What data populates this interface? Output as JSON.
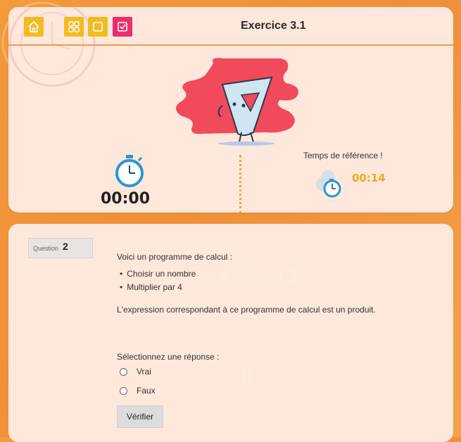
{
  "header": {
    "title": "Exercice 3.1",
    "buttons": [
      {
        "name": "home-button",
        "icon": "home-icon",
        "color": "#f2bb22"
      },
      {
        "name": "grid-button",
        "icon": "grid-icon",
        "color": "#f2bb22"
      },
      {
        "name": "square-button",
        "icon": "square-icon",
        "color": "#f2bb22"
      },
      {
        "name": "check-button",
        "icon": "checkbox-icon",
        "color": "#ea2e6e"
      }
    ]
  },
  "timer": {
    "value": "00:00"
  },
  "reference": {
    "label": "Temps de référence !",
    "time": "00:14"
  },
  "question": {
    "label": "Question",
    "number": "2",
    "intro": "Voici un programme de calcul :",
    "steps": [
      "Choisir un nombre",
      "Multiplier par 4"
    ],
    "statement": "L'expression correspondant à ce programme de calcul est un produit.",
    "prompt": "Sélectionnez une réponse :",
    "options": [
      "Vrai",
      "Faux"
    ],
    "submit_label": "Vérifier"
  },
  "colors": {
    "accent_orange": "#f39a3b",
    "yellow": "#f2bb22",
    "pink": "#ea2e6e",
    "card": "#fde8db",
    "ref_time": "#f2a826"
  }
}
